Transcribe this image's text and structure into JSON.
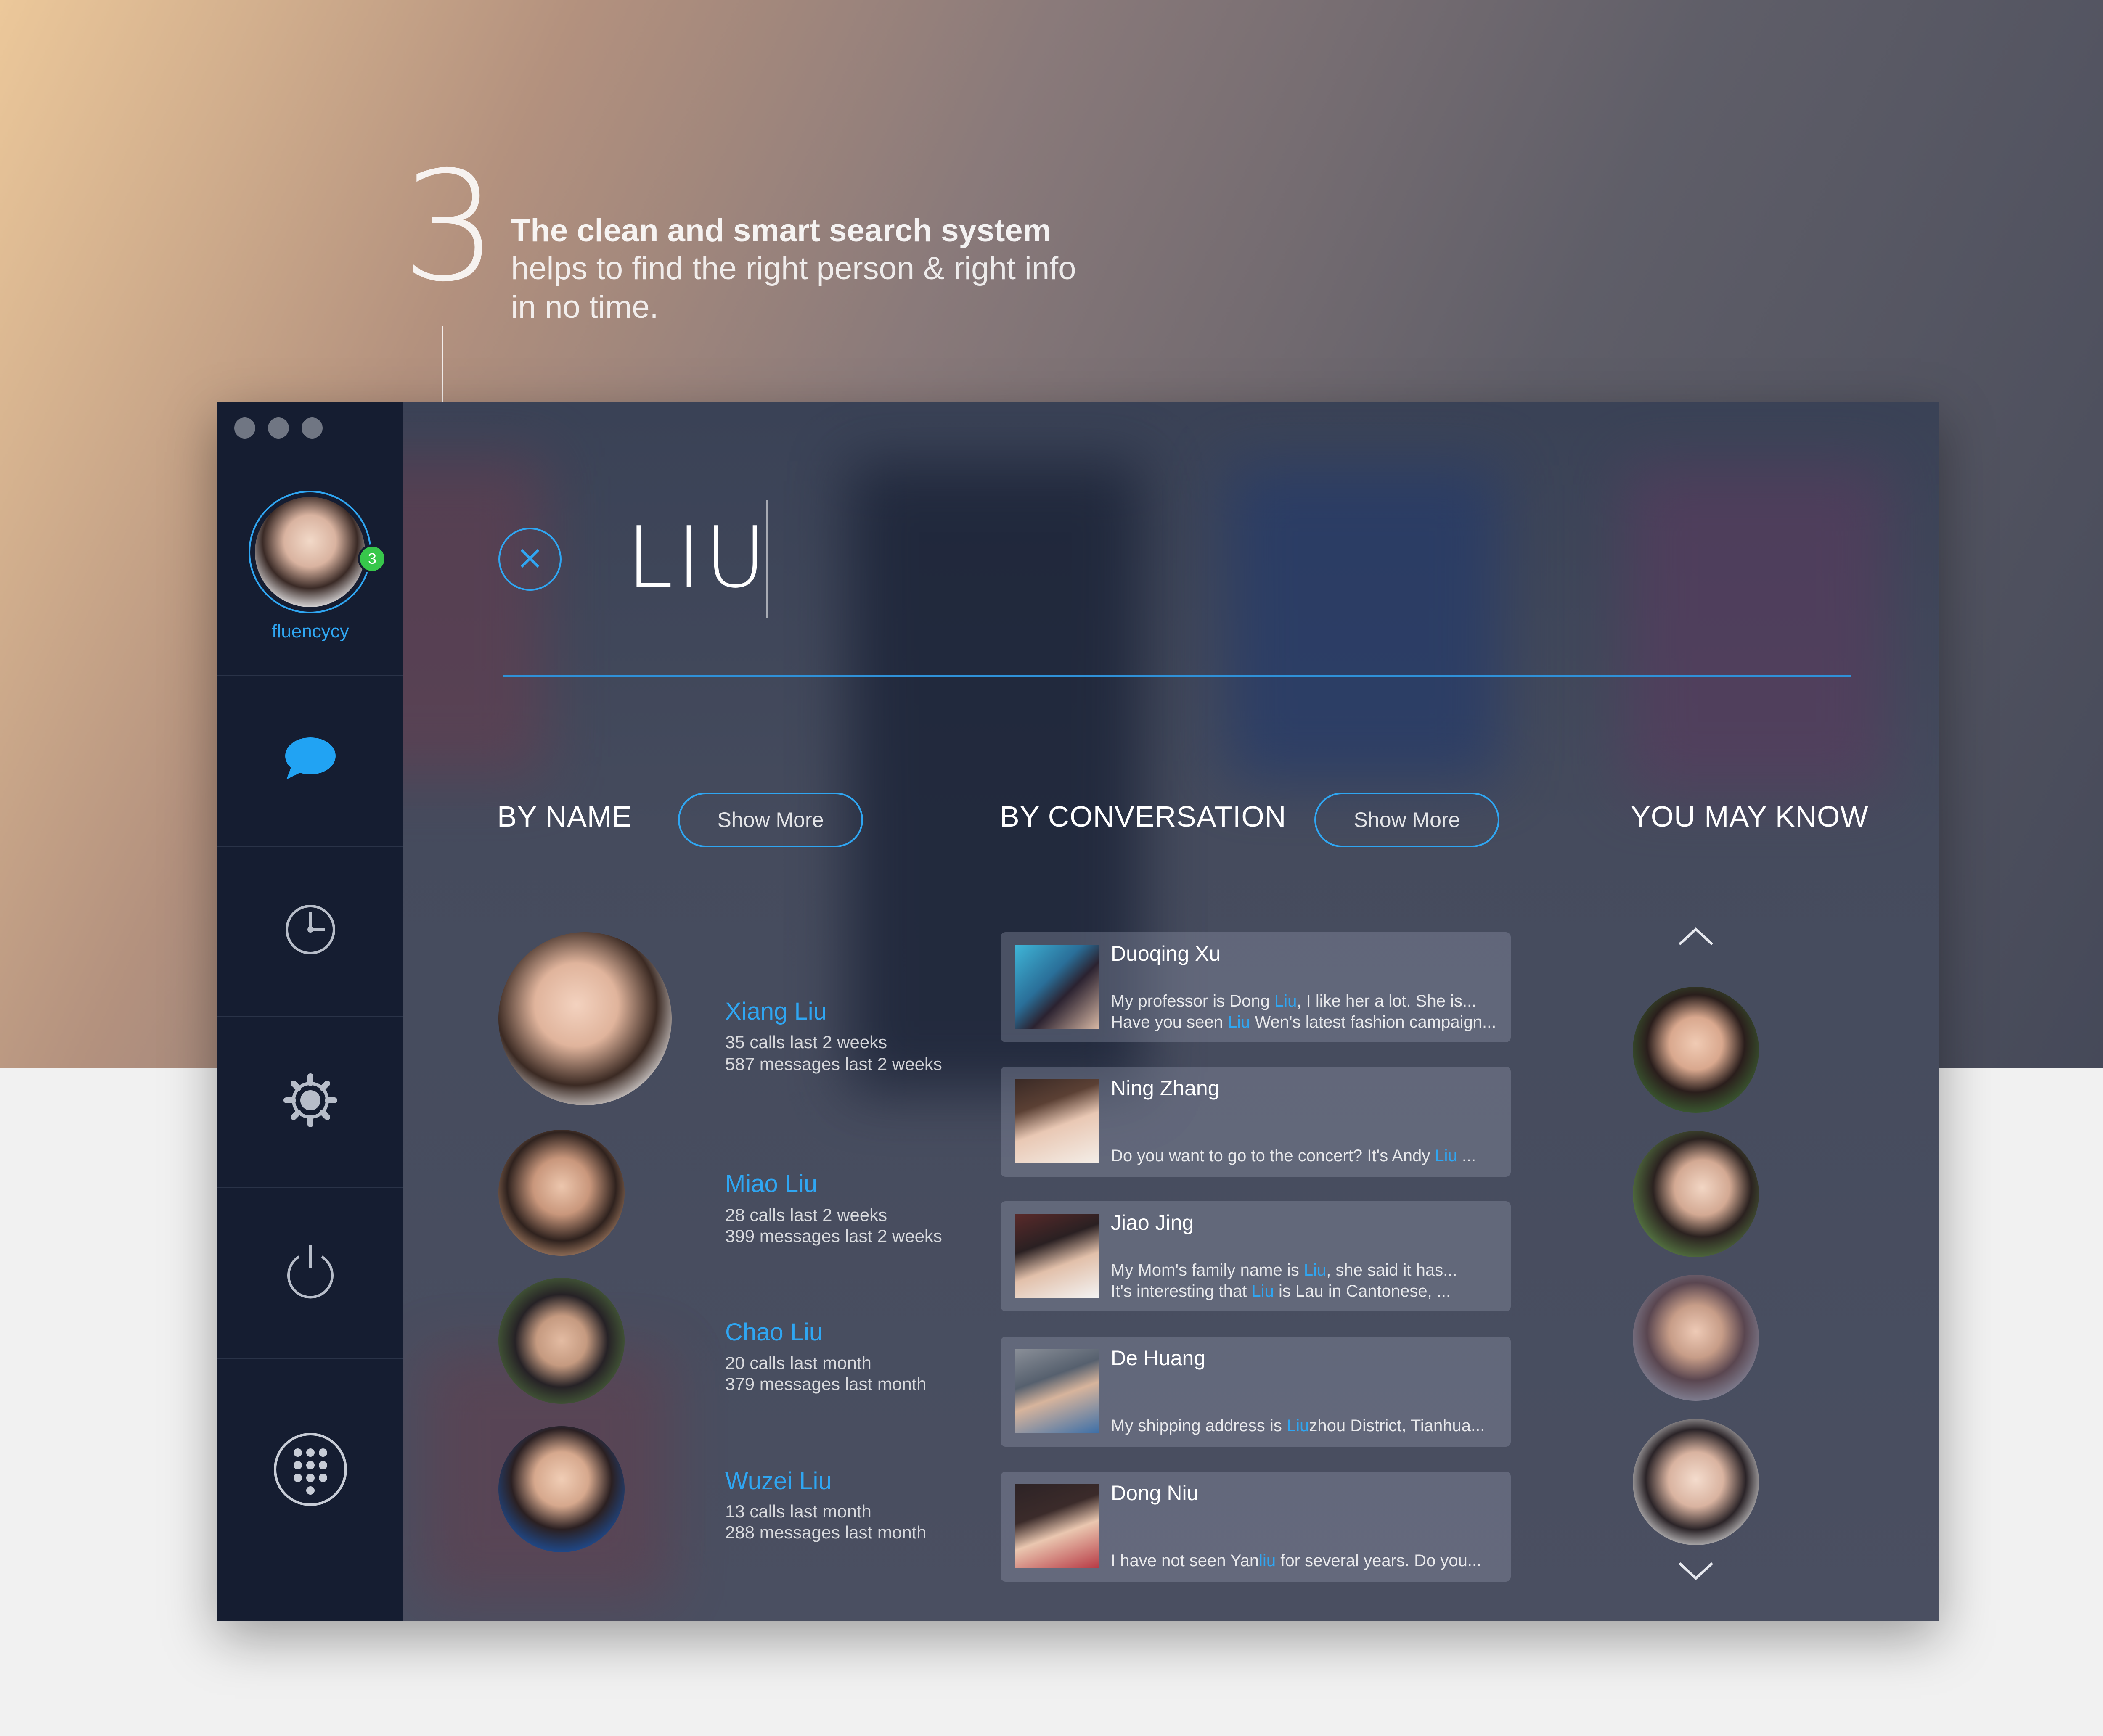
{
  "caption": {
    "step": "3",
    "title": "The clean and smart search system",
    "line1": "helps to find the right person & right info",
    "line2": "in no time."
  },
  "sidebar": {
    "username": "fluencycy",
    "badge_count": "3",
    "nav_icons": [
      "chat-icon",
      "clock-icon",
      "gear-icon",
      "power-icon",
      "dialpad-icon"
    ]
  },
  "search": {
    "query": "LIU"
  },
  "sections": {
    "by_name": "BY NAME",
    "by_conversation": "BY CONVERSATION",
    "you_may_know": "YOU MAY KNOW",
    "show_more": "Show More"
  },
  "by_name": [
    {
      "name": "Xiang Liu",
      "calls": "35 calls last 2 weeks",
      "messages": "587 messages last 2 weeks"
    },
    {
      "name": "Miao Liu",
      "calls": "28 calls last 2 weeks",
      "messages": "399 messages last 2 weeks"
    },
    {
      "name": "Chao Liu",
      "calls": "20 calls last month",
      "messages": "379 messages last month"
    },
    {
      "name": "Wuzei Liu",
      "calls": "13 calls last month",
      "messages": "288 messages last month"
    }
  ],
  "conversations": [
    {
      "name": "Duoqing Xu",
      "l1a": "My professor is Dong ",
      "l1h": "Liu",
      "l1b": ", I like her a lot. She is...",
      "l2a": "Have you seen ",
      "l2h": "Liu",
      "l2b": " Wen's latest fashion campaign..."
    },
    {
      "name": "Ning Zhang",
      "l1a": "Do you want to go to the concert? It's Andy ",
      "l1h": "Liu",
      "l1b": " ..."
    },
    {
      "name": "Jiao Jing",
      "l1a": "My Mom's family name is ",
      "l1h": "Liu",
      "l1b": ", she said it has...",
      "l2a": "It's interesting that ",
      "l2h": "Liu",
      "l2b": " is Lau in Cantonese, ..."
    },
    {
      "name": "De Huang",
      "l1a": "My shipping address is ",
      "l1h": "Liu",
      "l1b": "zhou District, Tianhua..."
    },
    {
      "name": "Dong Niu",
      "l1a": "I have not seen Yan",
      "l1h": "liu",
      "l1b": " for several years. Do you..."
    }
  ],
  "colors": {
    "accent": "#2fa6f2",
    "sidebar": "#151d31",
    "online_badge": "#37c74b"
  }
}
